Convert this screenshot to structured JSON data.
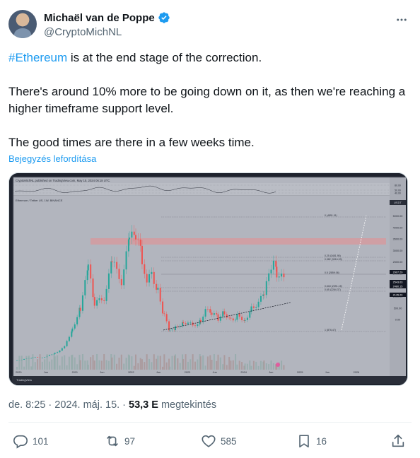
{
  "author": {
    "display_name": "Michaël van de Poppe",
    "handle": "@CryptoMichNL",
    "verified": true
  },
  "post": {
    "hashtag": "#Ethereum",
    "line1_rest": " is at the end stage of the correction.",
    "line2": "There's around 10% more to be going down on it, as then we're reaching a higher timeframe support level.",
    "line3": "The good times are there in a few weeks time.",
    "translate_label": "Bejegyzés lefordítása"
  },
  "chart_image": {
    "header_text": "CryptoMichNL published on TradingView.com, May 15, 2024 06:18 UTC",
    "symbol_line": "Ethereum / Tether US, 1W, BINANCE",
    "currency": "USDT",
    "price_scale": [
      "5000.00",
      "4000.00",
      "3500.00",
      "3000.00",
      "2500.00",
      "2000.00",
      "1500.00",
      "1000.00",
      "500.00",
      "0.00"
    ],
    "price_tags": [
      "2907.29",
      "2543.03",
      "2480.15",
      "2145.29"
    ],
    "fib_labels": [
      "0 (4851.01)",
      "0.25 (3451.95)",
      "0.382 (3316.93)",
      "0.5 (2859.06)",
      "0.618 (2391.15)",
      "0.65 (2264.37)",
      "1 (876.47)"
    ],
    "time_axis": [
      "2020",
      "Jun",
      "2021",
      "Jun",
      "2022",
      "Jun",
      "2023",
      "Jun",
      "2024",
      "Jun",
      "2025",
      "Jun",
      "2026"
    ],
    "logo_text": "TradingView",
    "oscillator_levels": [
      "80.00",
      "50.00",
      "40.00"
    ]
  },
  "meta": {
    "time": "de. 8:25",
    "separator": "·",
    "date": "2024. máj. 15.",
    "views_count": "53,3 E",
    "views_label": "megtekintés"
  },
  "actions": {
    "replies": "101",
    "reposts": "97",
    "likes": "585",
    "bookmarks": "16"
  },
  "colors": {
    "accent": "#1d9bf0",
    "candle_up": "#26a69a",
    "candle_down": "#ef5350",
    "resistance_zone": "#e2a4a8"
  }
}
